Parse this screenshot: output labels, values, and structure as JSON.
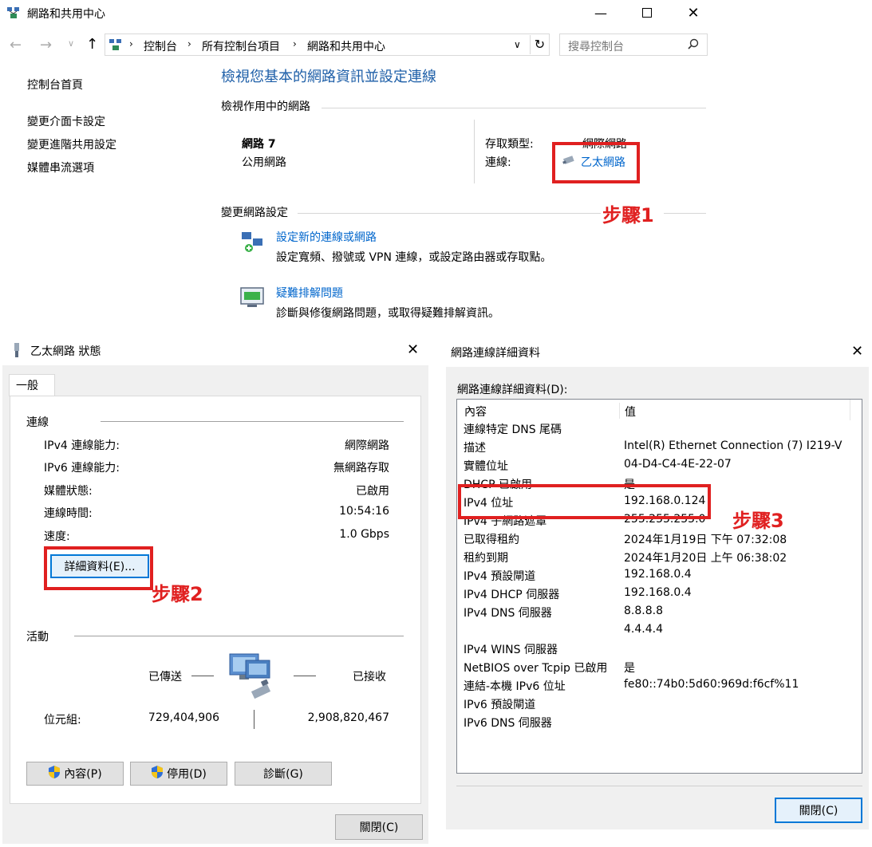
{
  "main_window": {
    "title": "網路和共用中心",
    "nav": {
      "breadcrumb": [
        "控制台",
        "所有控制台項目",
        "網路和共用中心"
      ],
      "search_placeholder": "搜尋控制台"
    },
    "sidebar": {
      "items": [
        "控制台首頁",
        "變更介面卡設定",
        "變更進階共用設定",
        "媒體串流選項"
      ]
    },
    "page_title": "檢視您基本的網路資訊並設定連線",
    "active_networks_heading": "檢視作用中的網路",
    "network": {
      "name": "網路 7",
      "type": "公用網路",
      "access_type_label": "存取類型:",
      "access_type_value": "網際網路",
      "connection_label": "連線:",
      "connection_value": "乙太網路"
    },
    "change_settings_heading": "變更網路設定",
    "tasks": [
      {
        "title": "設定新的連線或網路",
        "desc": "設定寬頻、撥號或 VPN 連線，或設定路由器或存取點。"
      },
      {
        "title": "疑難排解問題",
        "desc": "診斷與修復網路問題，或取得疑難排解資訊。"
      }
    ]
  },
  "status_dialog": {
    "title": "乙太網路 狀態",
    "tab": "一般",
    "connection_heading": "連線",
    "rows": [
      {
        "label": "IPv4 連線能力:",
        "value": "網際網路"
      },
      {
        "label": "IPv6 連線能力:",
        "value": "無網路存取"
      },
      {
        "label": "媒體狀態:",
        "value": "已啟用"
      },
      {
        "label": "連線時間:",
        "value": "10:54:16"
      },
      {
        "label": "速度:",
        "value": "1.0 Gbps"
      }
    ],
    "details_button": "詳細資料(E)...",
    "activity_heading": "活動",
    "sent_label": "已傳送",
    "received_label": "已接收",
    "bytes_label": "位元組:",
    "bytes_sent": "729,404,906",
    "bytes_received": "2,908,820,467",
    "buttons": [
      "內容(P)",
      "停用(D)",
      "診斷(G)"
    ],
    "close_button": "關閉(C)"
  },
  "details_dialog": {
    "title": "網路連線詳細資料",
    "list_label": "網路連線詳細資料(D):",
    "col_property": "內容",
    "col_value": "值",
    "rows": [
      {
        "prop": "連線特定 DNS 尾碼",
        "val": ""
      },
      {
        "prop": "描述",
        "val": "Intel(R) Ethernet Connection (7) I219-V"
      },
      {
        "prop": "實體位址",
        "val": "04-D4-C4-4E-22-07"
      },
      {
        "prop": "DHCP 已啟用",
        "val": "是"
      },
      {
        "prop": "IPv4 位址",
        "val": "192.168.0.124"
      },
      {
        "prop": "IPv4 子網路遮罩",
        "val": "255.255.255.0"
      },
      {
        "prop": "已取得租約",
        "val": "2024年1月19日 下午 07:32:08"
      },
      {
        "prop": "租約到期",
        "val": "2024年1月20日 上午 06:38:02"
      },
      {
        "prop": "IPv4 預設閘道",
        "val": "192.168.0.4"
      },
      {
        "prop": "IPv4 DHCP 伺服器",
        "val": "192.168.0.4"
      },
      {
        "prop": "IPv4 DNS 伺服器",
        "val": "8.8.8.8"
      },
      {
        "prop": "",
        "val": "4.4.4.4"
      },
      {
        "prop": "IPv4 WINS 伺服器",
        "val": ""
      },
      {
        "prop": "NetBIOS over Tcpip 已啟用",
        "val": "是"
      },
      {
        "prop": "連結-本機 IPv6 位址",
        "val": "fe80::74b0:5d60:969d:f6cf%11"
      },
      {
        "prop": "IPv6 預設閘道",
        "val": ""
      },
      {
        "prop": "IPv6 DNS 伺服器",
        "val": ""
      }
    ],
    "close_button": "關閉(C)"
  },
  "annotations": {
    "step1": "步驟1",
    "step2": "步驟2",
    "step3": "步驟3",
    "highlight_color": "#e02020"
  }
}
